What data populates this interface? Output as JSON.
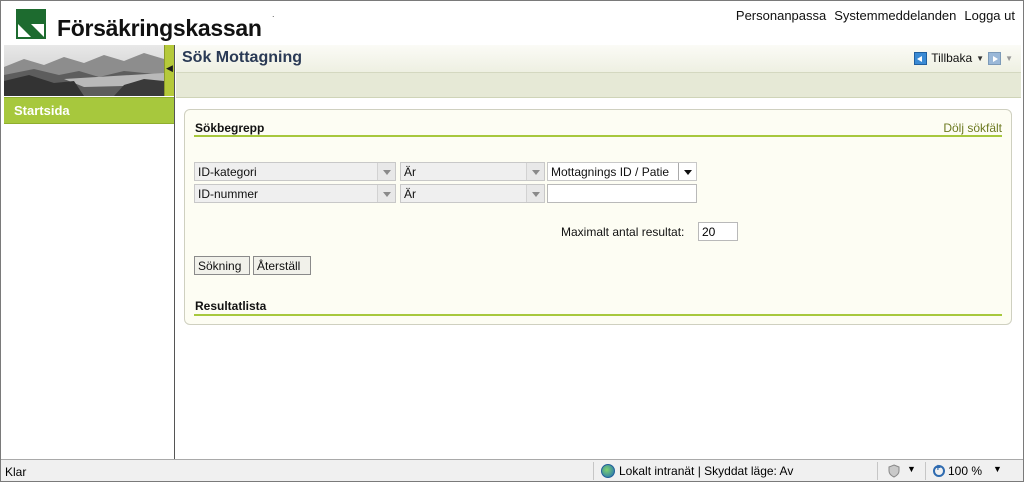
{
  "header": {
    "brand": "Försäkringskassan",
    "dot": ".",
    "links": [
      "Personanpassa",
      "Systemmeddelanden",
      "Logga ut"
    ]
  },
  "nav": {
    "start": "Startsida",
    "collapse_glyph": "◀"
  },
  "page": {
    "title": "Sök Mottagning",
    "back": "Tillbaka"
  },
  "search": {
    "title": "Sökbegrepp",
    "hide_link": "Dölj sökfält",
    "rows": [
      {
        "field": "ID-kategori",
        "operator": "Är",
        "value": "Mottagnings ID / Patie"
      },
      {
        "field": "ID-nummer",
        "operator": "Är",
        "value": ""
      }
    ],
    "max_label": "Maximalt antal resultat:",
    "max_value": "20",
    "search_button": "Sökning",
    "reset_button": "Återställ",
    "results_title": "Resultatlista"
  },
  "statusbar": {
    "status": "Klar",
    "zone": "Lokalt intranät | Skyddat läge: Av",
    "zoom": "100 %"
  },
  "icons": {
    "logo": "forsakringskassan-logo-icon",
    "back": "back-arrow-icon",
    "forward": "forward-arrow-icon",
    "globe": "intranet-globe-icon",
    "shield": "security-shield-icon",
    "zoom": "zoom-icon"
  }
}
